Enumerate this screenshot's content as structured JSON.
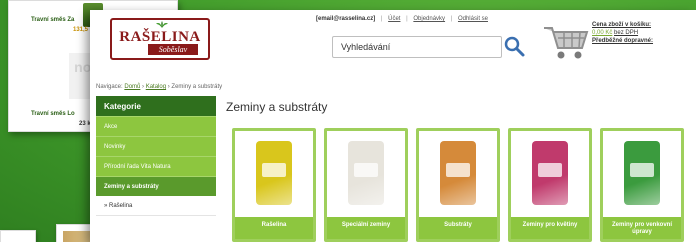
{
  "background_card": {
    "name_1": "Travní směs Za",
    "price_1": "131,5",
    "thumb": "no imag",
    "name_2": "Travní směs Lo",
    "price_2": "23 k"
  },
  "logo": {
    "title": "RAŠELINA",
    "subtitle": "Soběslav"
  },
  "header": {
    "email": "[email@rasselina.cz]",
    "links": [
      "Účet",
      "Objednávky",
      "Odhlásit se"
    ]
  },
  "search": {
    "placeholder": "Vyhledávání"
  },
  "cart": {
    "title": "Cena zboží v košíku:",
    "price": "0,00 Kč",
    "price_note": "bez DPH",
    "shipping": "Předběžné dopravné:"
  },
  "breadcrumb": {
    "prefix": "Navigace:",
    "home": "Domů",
    "catalog": "Katalog",
    "current": "Zeminy a substráty"
  },
  "sidebar": {
    "heading": "Kategorie",
    "items": [
      "Akce",
      "Novinky",
      "Přírodní řada Vita Natura",
      "Zeminy a substráty"
    ],
    "active_index": 3,
    "sub_items": [
      "» Rašelina"
    ]
  },
  "page_title": "Zeminy a substráty",
  "products": [
    {
      "name": "Rašelina",
      "color": "#d9c61c"
    },
    {
      "name": "Speciální zeminy",
      "color": "#e7e4dc"
    },
    {
      "name": "Substráty",
      "color": "#d58a3a"
    },
    {
      "name": "Zeminy pro květiny",
      "color": "#c03a6c"
    },
    {
      "name": "Zeminy pro venkovní úpravy",
      "color": "#3b9b3e"
    }
  ],
  "colors": {
    "brand_dark": "#2f6f1d",
    "brand_light": "#8dc63f",
    "logo_red": "#8a1a1a",
    "background": "#4fa832"
  }
}
